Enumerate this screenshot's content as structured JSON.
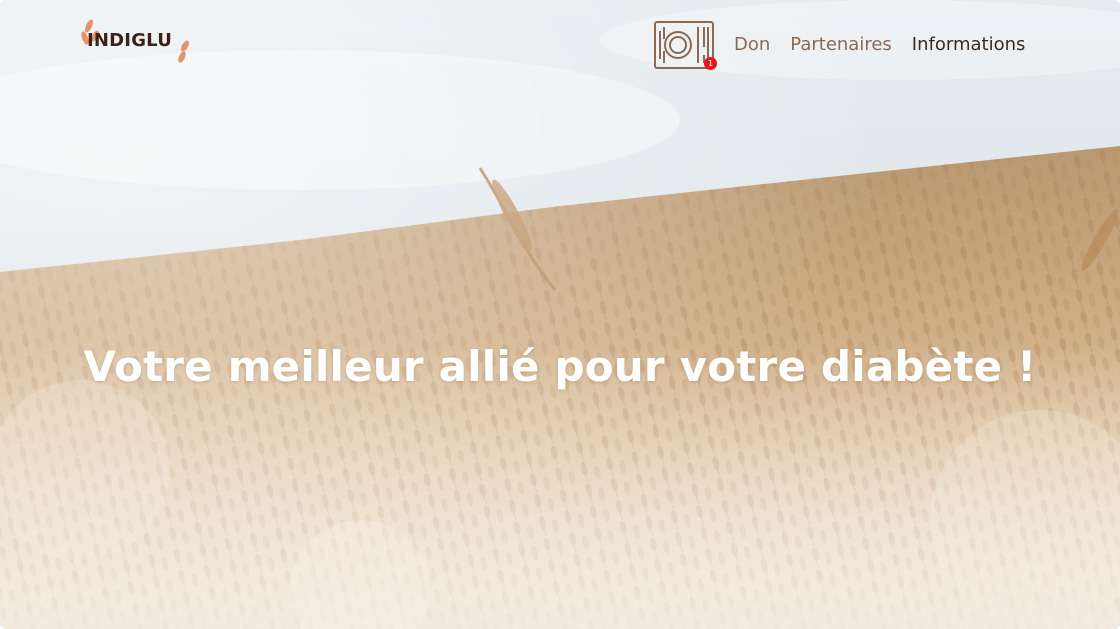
{
  "brand": {
    "name": "INDIGLU",
    "text_color": "#3b2416",
    "leaf_color": "#e0966a"
  },
  "header": {
    "cart": {
      "icon": "plate-cutlery-icon",
      "badge_count": "1",
      "badge_color": "#e8141b"
    },
    "nav": {
      "don": "Don",
      "partenaires": "Partenaires",
      "informations": "Informations"
    }
  },
  "hero": {
    "headline": "Votre meilleur allié pour votre diabète !",
    "background": "wheat-field-image",
    "sky_color": "#dfe7ee",
    "wheat_color": "#c9a57a"
  }
}
